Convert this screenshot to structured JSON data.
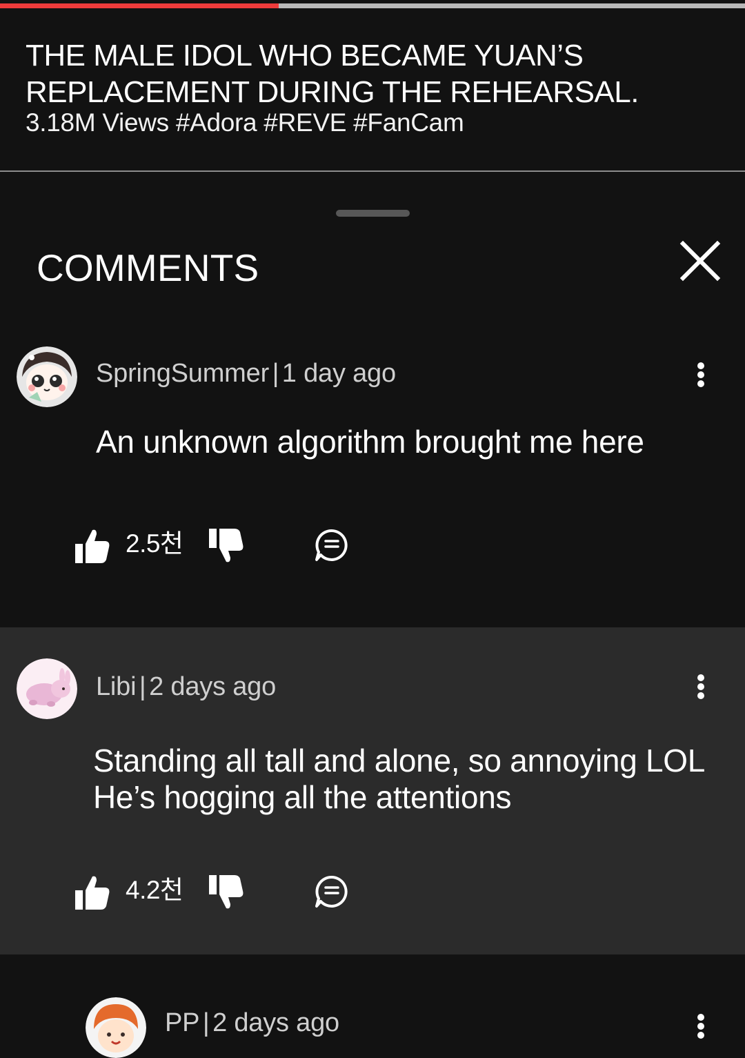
{
  "player": {
    "progress_fraction": 0.374
  },
  "video": {
    "title_line1": "THE MALE IDOL WHO BECAME YUAN’S",
    "title_line2": "REPLACEMENT DURING THE REHEARSAL.",
    "meta": "3.18M Views #Adora #REVE #FanCam"
  },
  "comments_sheet": {
    "title": "COMMENTS",
    "close_icon": "close-icon"
  },
  "comments": [
    {
      "author": "SpringSummer",
      "time": "1 day ago",
      "text": "An unknown algorithm brought me here",
      "likes": "2.5천"
    },
    {
      "author": "Libi",
      "time": "2 days ago",
      "text": "Standing all tall and alone, so annoying LOL\nHe’s hogging all the attentions",
      "likes": "4.2천"
    },
    {
      "author": "PP",
      "time": "2 days ago"
    }
  ],
  "colors": {
    "progress": "#ee3b3b",
    "background": "#121212",
    "highlight_comment": "#2b2b2b"
  }
}
